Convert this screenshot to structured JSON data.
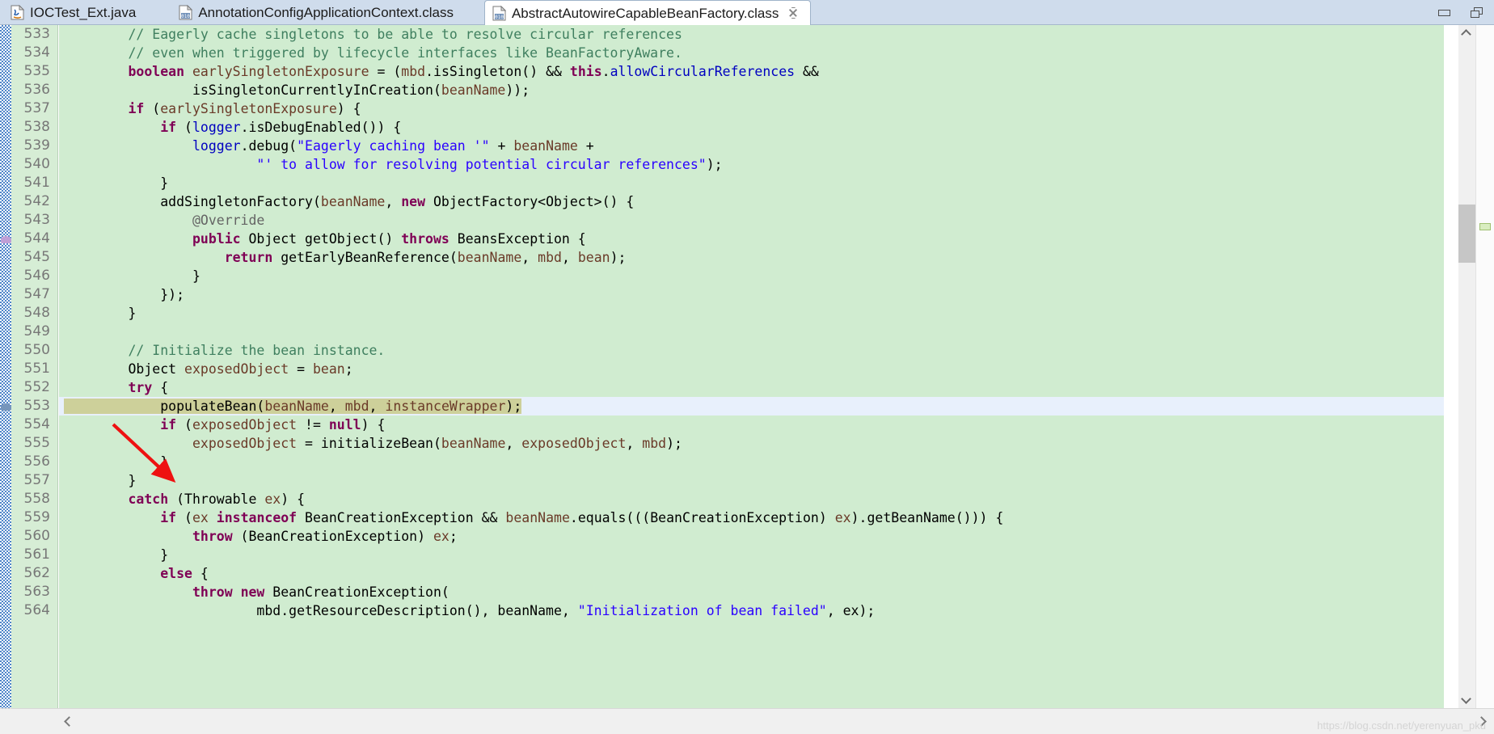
{
  "window": {
    "minimize_icon": "minimize-icon",
    "maximize_icon": "maximize-restore-icon"
  },
  "tabs": [
    {
      "label": "IOCTest_Ext.java",
      "icon": "java-file-icon",
      "active": false,
      "closable": false
    },
    {
      "label": "AnnotationConfigApplicationContext.class",
      "icon": "class-file-icon",
      "active": false,
      "closable": false
    },
    {
      "label": "AbstractAutowireCapableBeanFactory.class",
      "icon": "class-file-icon",
      "active": true,
      "closable": true
    }
  ],
  "editor": {
    "first_line": 533,
    "selected_line": 553,
    "line_numbers": [
      533,
      534,
      535,
      536,
      537,
      538,
      539,
      540,
      541,
      542,
      543,
      544,
      545,
      546,
      547,
      548,
      549,
      550,
      551,
      552,
      553,
      554,
      555,
      556,
      557,
      558,
      559,
      560,
      561,
      562,
      563,
      564
    ],
    "lines": [
      {
        "n": 533,
        "tokens": [
          {
            "t": "plain",
            "v": "\t\t"
          },
          {
            "t": "comment",
            "v": "// Eagerly cache singletons to be able to resolve circular references"
          }
        ]
      },
      {
        "n": 534,
        "tokens": [
          {
            "t": "plain",
            "v": "\t\t"
          },
          {
            "t": "comment",
            "v": "// even when triggered by lifecycle interfaces like BeanFactoryAware."
          }
        ]
      },
      {
        "n": 535,
        "tokens": [
          {
            "t": "plain",
            "v": "\t\t"
          },
          {
            "t": "keyword",
            "v": "boolean"
          },
          {
            "t": "plain",
            "v": " "
          },
          {
            "t": "var",
            "v": "earlySingletonExposure"
          },
          {
            "t": "plain",
            "v": " = ("
          },
          {
            "t": "var",
            "v": "mbd"
          },
          {
            "t": "plain",
            "v": ".isSingleton() && "
          },
          {
            "t": "keyword",
            "v": "this"
          },
          {
            "t": "plain",
            "v": "."
          },
          {
            "t": "field",
            "v": "allowCircularReferences"
          },
          {
            "t": "plain",
            "v": " &&"
          }
        ]
      },
      {
        "n": 536,
        "tokens": [
          {
            "t": "plain",
            "v": "\t\t\t\tisSingletonCurrentlyInCreation("
          },
          {
            "t": "var",
            "v": "beanName"
          },
          {
            "t": "plain",
            "v": "));"
          }
        ]
      },
      {
        "n": 537,
        "tokens": [
          {
            "t": "plain",
            "v": "\t\t"
          },
          {
            "t": "keyword",
            "v": "if"
          },
          {
            "t": "plain",
            "v": " ("
          },
          {
            "t": "var",
            "v": "earlySingletonExposure"
          },
          {
            "t": "plain",
            "v": ") {"
          }
        ]
      },
      {
        "n": 538,
        "tokens": [
          {
            "t": "plain",
            "v": "\t\t\t"
          },
          {
            "t": "keyword",
            "v": "if"
          },
          {
            "t": "plain",
            "v": " ("
          },
          {
            "t": "field",
            "v": "logger"
          },
          {
            "t": "plain",
            "v": ".isDebugEnabled()) {"
          }
        ]
      },
      {
        "n": 539,
        "tokens": [
          {
            "t": "plain",
            "v": "\t\t\t\t"
          },
          {
            "t": "field",
            "v": "logger"
          },
          {
            "t": "plain",
            "v": ".debug("
          },
          {
            "t": "string",
            "v": "\"Eagerly caching bean '\""
          },
          {
            "t": "plain",
            "v": " + "
          },
          {
            "t": "var",
            "v": "beanName"
          },
          {
            "t": "plain",
            "v": " +"
          }
        ]
      },
      {
        "n": 540,
        "tokens": [
          {
            "t": "plain",
            "v": "\t\t\t\t\t\t"
          },
          {
            "t": "string",
            "v": "\"' to allow for resolving potential circular references\""
          },
          {
            "t": "plain",
            "v": ");"
          }
        ]
      },
      {
        "n": 541,
        "tokens": [
          {
            "t": "plain",
            "v": "\t\t\t}"
          }
        ]
      },
      {
        "n": 542,
        "tokens": [
          {
            "t": "plain",
            "v": "\t\t\taddSingletonFactory("
          },
          {
            "t": "var",
            "v": "beanName"
          },
          {
            "t": "plain",
            "v": ", "
          },
          {
            "t": "keyword",
            "v": "new"
          },
          {
            "t": "plain",
            "v": " ObjectFactory<Object>() {"
          }
        ]
      },
      {
        "n": 543,
        "tokens": [
          {
            "t": "plain",
            "v": "\t\t\t\t"
          },
          {
            "t": "annotation",
            "v": "@Override"
          }
        ]
      },
      {
        "n": 544,
        "tokens": [
          {
            "t": "plain",
            "v": "\t\t\t\t"
          },
          {
            "t": "keyword",
            "v": "public"
          },
          {
            "t": "plain",
            "v": " Object getObject() "
          },
          {
            "t": "keyword",
            "v": "throws"
          },
          {
            "t": "plain",
            "v": " BeansException {"
          }
        ]
      },
      {
        "n": 545,
        "tokens": [
          {
            "t": "plain",
            "v": "\t\t\t\t\t"
          },
          {
            "t": "keyword",
            "v": "return"
          },
          {
            "t": "plain",
            "v": " getEarlyBeanReference("
          },
          {
            "t": "var",
            "v": "beanName"
          },
          {
            "t": "plain",
            "v": ", "
          },
          {
            "t": "var",
            "v": "mbd"
          },
          {
            "t": "plain",
            "v": ", "
          },
          {
            "t": "var",
            "v": "bean"
          },
          {
            "t": "plain",
            "v": ");"
          }
        ]
      },
      {
        "n": 546,
        "tokens": [
          {
            "t": "plain",
            "v": "\t\t\t\t}"
          }
        ]
      },
      {
        "n": 547,
        "tokens": [
          {
            "t": "plain",
            "v": "\t\t\t});"
          }
        ]
      },
      {
        "n": 548,
        "tokens": [
          {
            "t": "plain",
            "v": "\t\t}"
          }
        ]
      },
      {
        "n": 549,
        "tokens": [
          {
            "t": "plain",
            "v": ""
          }
        ]
      },
      {
        "n": 550,
        "tokens": [
          {
            "t": "plain",
            "v": "\t\t"
          },
          {
            "t": "comment",
            "v": "// Initialize the bean instance."
          }
        ]
      },
      {
        "n": 551,
        "tokens": [
          {
            "t": "plain",
            "v": "\t\tObject "
          },
          {
            "t": "var",
            "v": "exposedObject"
          },
          {
            "t": "plain",
            "v": " = "
          },
          {
            "t": "var",
            "v": "bean"
          },
          {
            "t": "plain",
            "v": ";"
          }
        ]
      },
      {
        "n": 552,
        "tokens": [
          {
            "t": "plain",
            "v": "\t\t"
          },
          {
            "t": "keyword",
            "v": "try"
          },
          {
            "t": "plain",
            "v": " {"
          }
        ]
      },
      {
        "n": 553,
        "tokens": [
          {
            "t": "plain",
            "v": "\t\t\tpopulateBean("
          },
          {
            "t": "var",
            "v": "beanName"
          },
          {
            "t": "plain",
            "v": ", "
          },
          {
            "t": "var",
            "v": "mbd"
          },
          {
            "t": "plain",
            "v": ", "
          },
          {
            "t": "var",
            "v": "instanceWrapper"
          },
          {
            "t": "plain",
            "v": ");"
          }
        ]
      },
      {
        "n": 554,
        "tokens": [
          {
            "t": "plain",
            "v": "\t\t\t"
          },
          {
            "t": "keyword",
            "v": "if"
          },
          {
            "t": "plain",
            "v": " ("
          },
          {
            "t": "var",
            "v": "exposedObject"
          },
          {
            "t": "plain",
            "v": " != "
          },
          {
            "t": "keyword",
            "v": "null"
          },
          {
            "t": "plain",
            "v": ") {"
          }
        ]
      },
      {
        "n": 555,
        "tokens": [
          {
            "t": "plain",
            "v": "\t\t\t\t"
          },
          {
            "t": "var",
            "v": "exposedObject"
          },
          {
            "t": "plain",
            "v": " = initializeBean("
          },
          {
            "t": "var",
            "v": "beanName"
          },
          {
            "t": "plain",
            "v": ", "
          },
          {
            "t": "var",
            "v": "exposedObject"
          },
          {
            "t": "plain",
            "v": ", "
          },
          {
            "t": "var",
            "v": "mbd"
          },
          {
            "t": "plain",
            "v": ");"
          }
        ]
      },
      {
        "n": 556,
        "tokens": [
          {
            "t": "plain",
            "v": "\t\t\t}"
          }
        ]
      },
      {
        "n": 557,
        "tokens": [
          {
            "t": "plain",
            "v": "\t\t}"
          }
        ]
      },
      {
        "n": 558,
        "tokens": [
          {
            "t": "plain",
            "v": "\t\t"
          },
          {
            "t": "keyword",
            "v": "catch"
          },
          {
            "t": "plain",
            "v": " (Throwable "
          },
          {
            "t": "var",
            "v": "ex"
          },
          {
            "t": "plain",
            "v": ") {"
          }
        ]
      },
      {
        "n": 559,
        "tokens": [
          {
            "t": "plain",
            "v": "\t\t\t"
          },
          {
            "t": "keyword",
            "v": "if"
          },
          {
            "t": "plain",
            "v": " ("
          },
          {
            "t": "var",
            "v": "ex"
          },
          {
            "t": "plain",
            "v": " "
          },
          {
            "t": "keyword",
            "v": "instanceof"
          },
          {
            "t": "plain",
            "v": " BeanCreationException && "
          },
          {
            "t": "var",
            "v": "beanName"
          },
          {
            "t": "plain",
            "v": ".equals(((BeanCreationException) "
          },
          {
            "t": "var",
            "v": "ex"
          },
          {
            "t": "plain",
            "v": ").getBeanName())) {"
          }
        ]
      },
      {
        "n": 560,
        "tokens": [
          {
            "t": "plain",
            "v": "\t\t\t\t"
          },
          {
            "t": "keyword",
            "v": "throw"
          },
          {
            "t": "plain",
            "v": " (BeanCreationException) "
          },
          {
            "t": "var",
            "v": "ex"
          },
          {
            "t": "plain",
            "v": ";"
          }
        ]
      },
      {
        "n": 561,
        "tokens": [
          {
            "t": "plain",
            "v": "\t\t\t}"
          }
        ]
      },
      {
        "n": 562,
        "tokens": [
          {
            "t": "plain",
            "v": "\t\t\t"
          },
          {
            "t": "keyword",
            "v": "else"
          },
          {
            "t": "plain",
            "v": " {"
          }
        ]
      },
      {
        "n": 563,
        "tokens": [
          {
            "t": "plain",
            "v": "\t\t\t\t"
          },
          {
            "t": "keyword",
            "v": "throw"
          },
          {
            "t": "plain",
            "v": " "
          },
          {
            "t": "keyword",
            "v": "new"
          },
          {
            "t": "plain",
            "v": " BeanCreationException("
          }
        ]
      },
      {
        "n": 564,
        "tokens": [
          {
            "t": "plain",
            "v": "\t\t\t\t\t\tmbd.getResourceDescription(), beanName, "
          },
          {
            "t": "string",
            "v": "\"Initialization of bean failed\""
          },
          {
            "t": "plain",
            "v": ", ex);"
          }
        ]
      }
    ]
  },
  "annotation": {
    "arrow_color": "#ee1111",
    "arrow_name": "red-pointer-arrow",
    "points_to_line": 553
  },
  "scrollbars": {
    "vertical_up_icon": "chevron-up-icon",
    "vertical_down_icon": "chevron-down-icon",
    "horizontal_left_icon": "chevron-left-icon",
    "horizontal_right_icon": "chevron-right-icon"
  },
  "watermark": {
    "text": "https://blog.csdn.net/yerenyuan_pku"
  },
  "colors": {
    "editor_background": "#d0ecd0",
    "gutter_background": "#d6edd5",
    "selected_line_text_background": "#cdd09a",
    "selected_line_rest_background": "#e8f0fc",
    "tabbar_background": "#cfdcec",
    "comment": "#3f7f5f",
    "keyword": "#7f0055",
    "string": "#2a00ff",
    "field": "#0000c0",
    "local_variable": "#6a3a28"
  }
}
